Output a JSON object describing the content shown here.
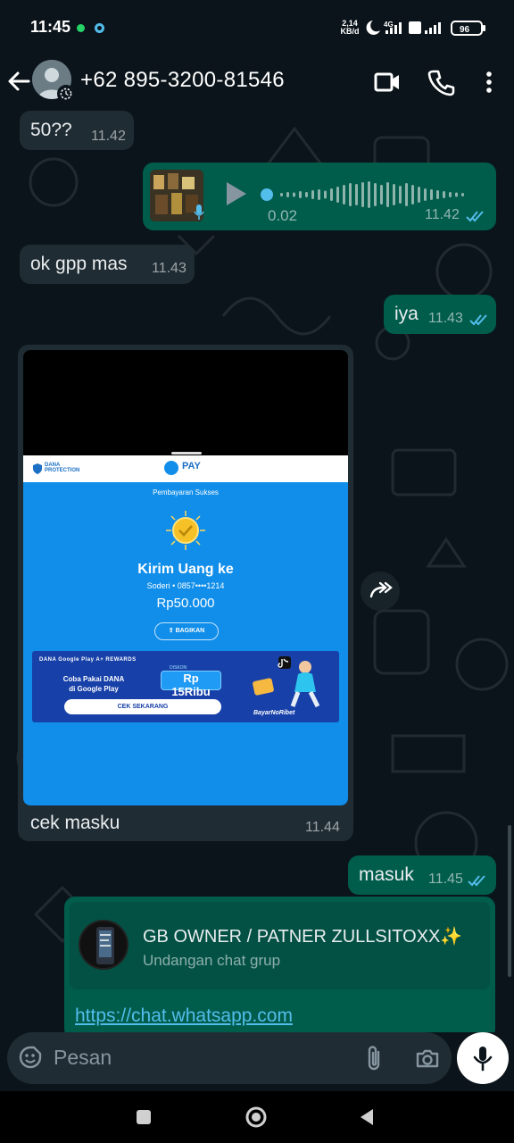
{
  "status_bar": {
    "time": "11:45",
    "net_speed": "2,14",
    "net_unit": "KB/d",
    "network": "4G",
    "battery": "96"
  },
  "header": {
    "contact": "+62 895-3200-81546"
  },
  "messages": [
    {
      "text": "50??",
      "time": "11.42"
    },
    {
      "voice_duration": "0.02",
      "time": "11.42"
    },
    {
      "text": "ok gpp mas",
      "time": "11.43"
    },
    {
      "text": "iya",
      "time": "11.43"
    },
    {
      "caption": "cek masku",
      "time": "11.44"
    },
    {
      "text": "masuk",
      "time": "11.45"
    }
  ],
  "receipt": {
    "protection_line1": "DANA",
    "protection_line2": "PROTECTION",
    "app": "PAY",
    "status": "Pembayaran Sukses",
    "title": "Kirim Uang ke",
    "recipient": "Soderi • 0857••••1214",
    "amount": "Rp50.000",
    "share_label": "BAGIKAN",
    "banner_brands": "DANA     Google Play     A+ REWARDS",
    "banner_line1": "Coba Pakai DANA",
    "banner_line2": "di Google Play",
    "banner_discount_label": "DISKON",
    "banner_discount": "Rp 15Ribu",
    "banner_cta": "CEK SEKARANG",
    "banner_tag": "BayarNoRibet"
  },
  "invite": {
    "group_name": "GB OWNER / PATNER ZULLSITOXX✨",
    "subtitle": "Undangan chat grup",
    "link": "https://chat.whatsapp.com"
  },
  "composer": {
    "placeholder": "Pesan"
  },
  "colors": {
    "background": "#0b141a",
    "incoming": "#202c33",
    "outgoing": "#005c4b",
    "read_ticks": "#53bdeb"
  }
}
